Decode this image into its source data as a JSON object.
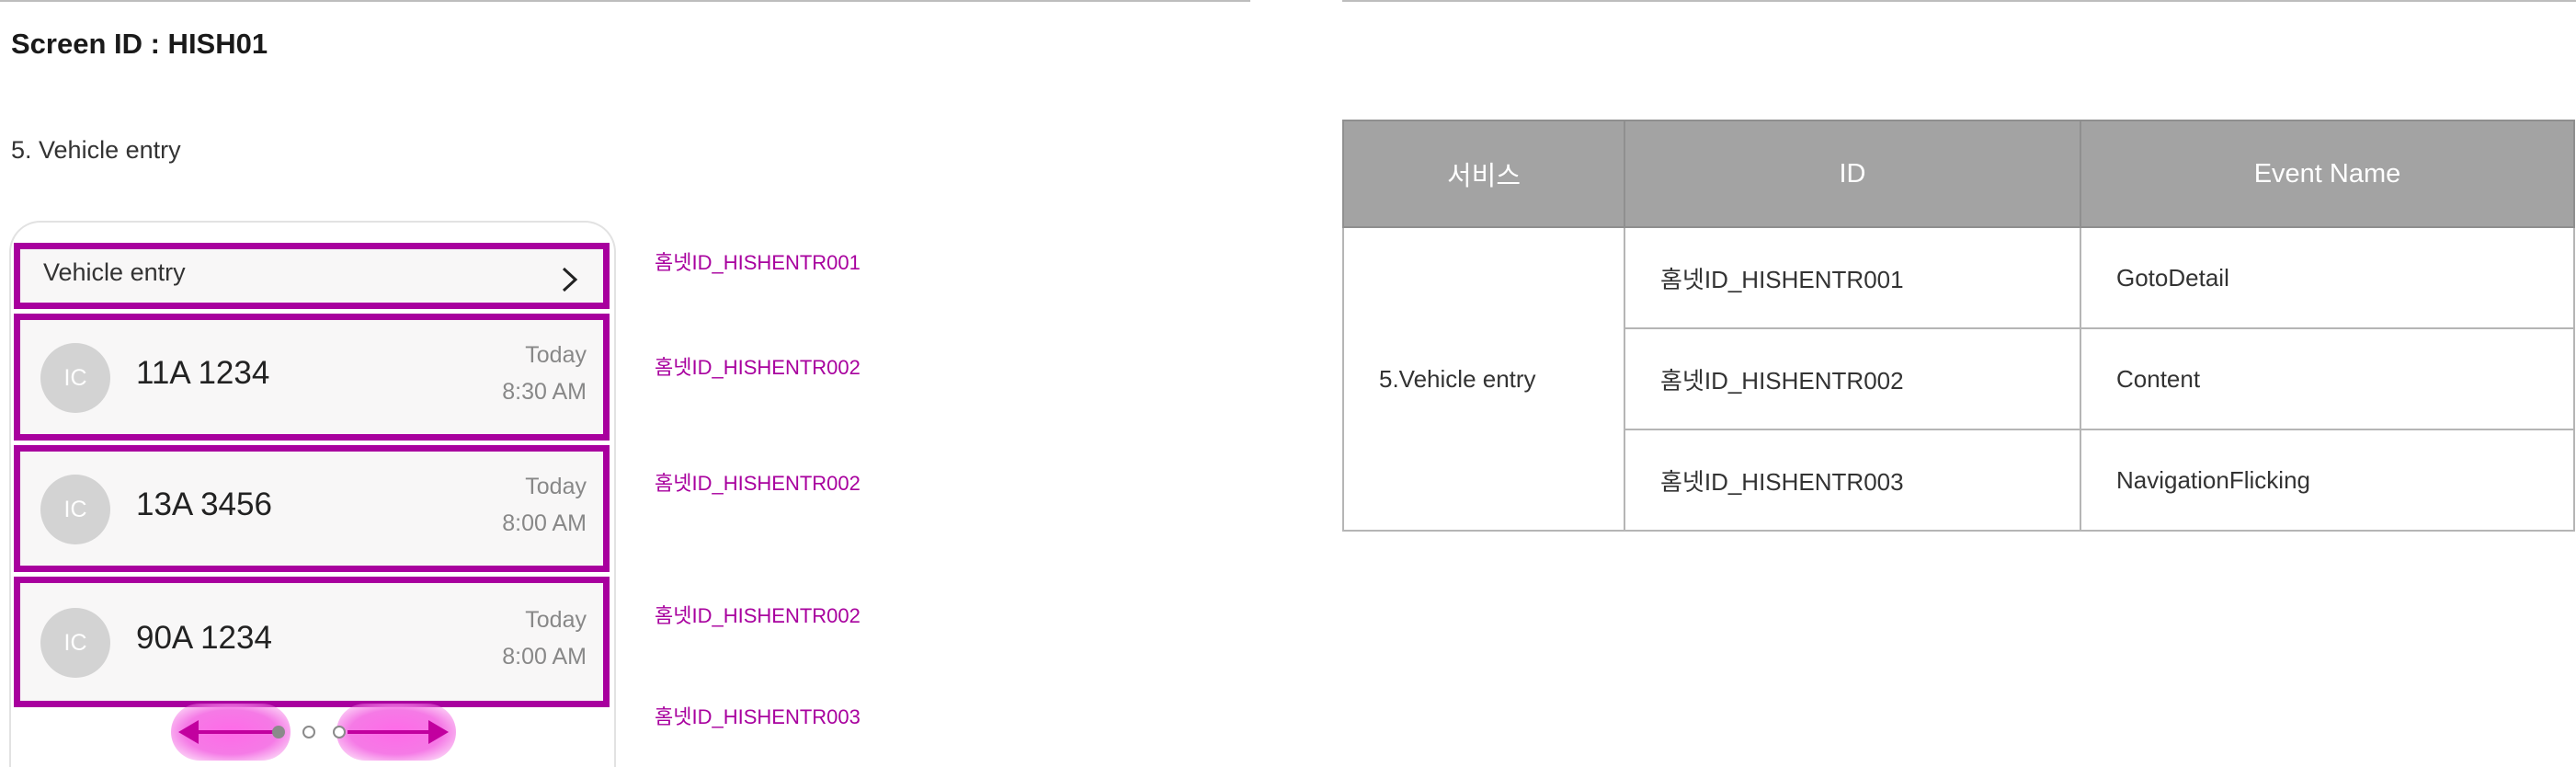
{
  "screen_id": "Screen ID : HISH01",
  "section_title": "5. Vehicle entry",
  "card": {
    "title": "Vehicle entry",
    "rows": [
      {
        "avatar": "IC",
        "plate": "11A 1234",
        "day": "Today",
        "time": "8:30 AM"
      },
      {
        "avatar": "IC",
        "plate": "13A 3456",
        "day": "Today",
        "time": "8:00 AM"
      },
      {
        "avatar": "IC",
        "plate": "90A 1234",
        "day": "Today",
        "time": "8:00 AM"
      }
    ],
    "pager": {
      "pages": 3,
      "current": 1
    }
  },
  "tags": [
    "홈넷ID_HISHENTR001",
    "홈넷ID_HISHENTR002",
    "홈넷ID_HISHENTR002",
    "홈넷ID_HISHENTR002",
    "홈넷ID_HISHENTR003"
  ],
  "table": {
    "headers": [
      "서비스",
      "ID",
      "Event Name"
    ],
    "service": "5.Vehicle entry",
    "rows": [
      {
        "id": "홈넷ID_HISHENTR001",
        "event": "GotoDetail"
      },
      {
        "id": "홈넷ID_HISHENTR002",
        "event": "Content"
      },
      {
        "id": "홈넷ID_HISHENTR003",
        "event": "NavigationFlicking"
      }
    ]
  },
  "colors": {
    "highlight": "#a8009e",
    "header_bg": "#a3a3a3",
    "avatar_bg": "#d3d3d3"
  }
}
